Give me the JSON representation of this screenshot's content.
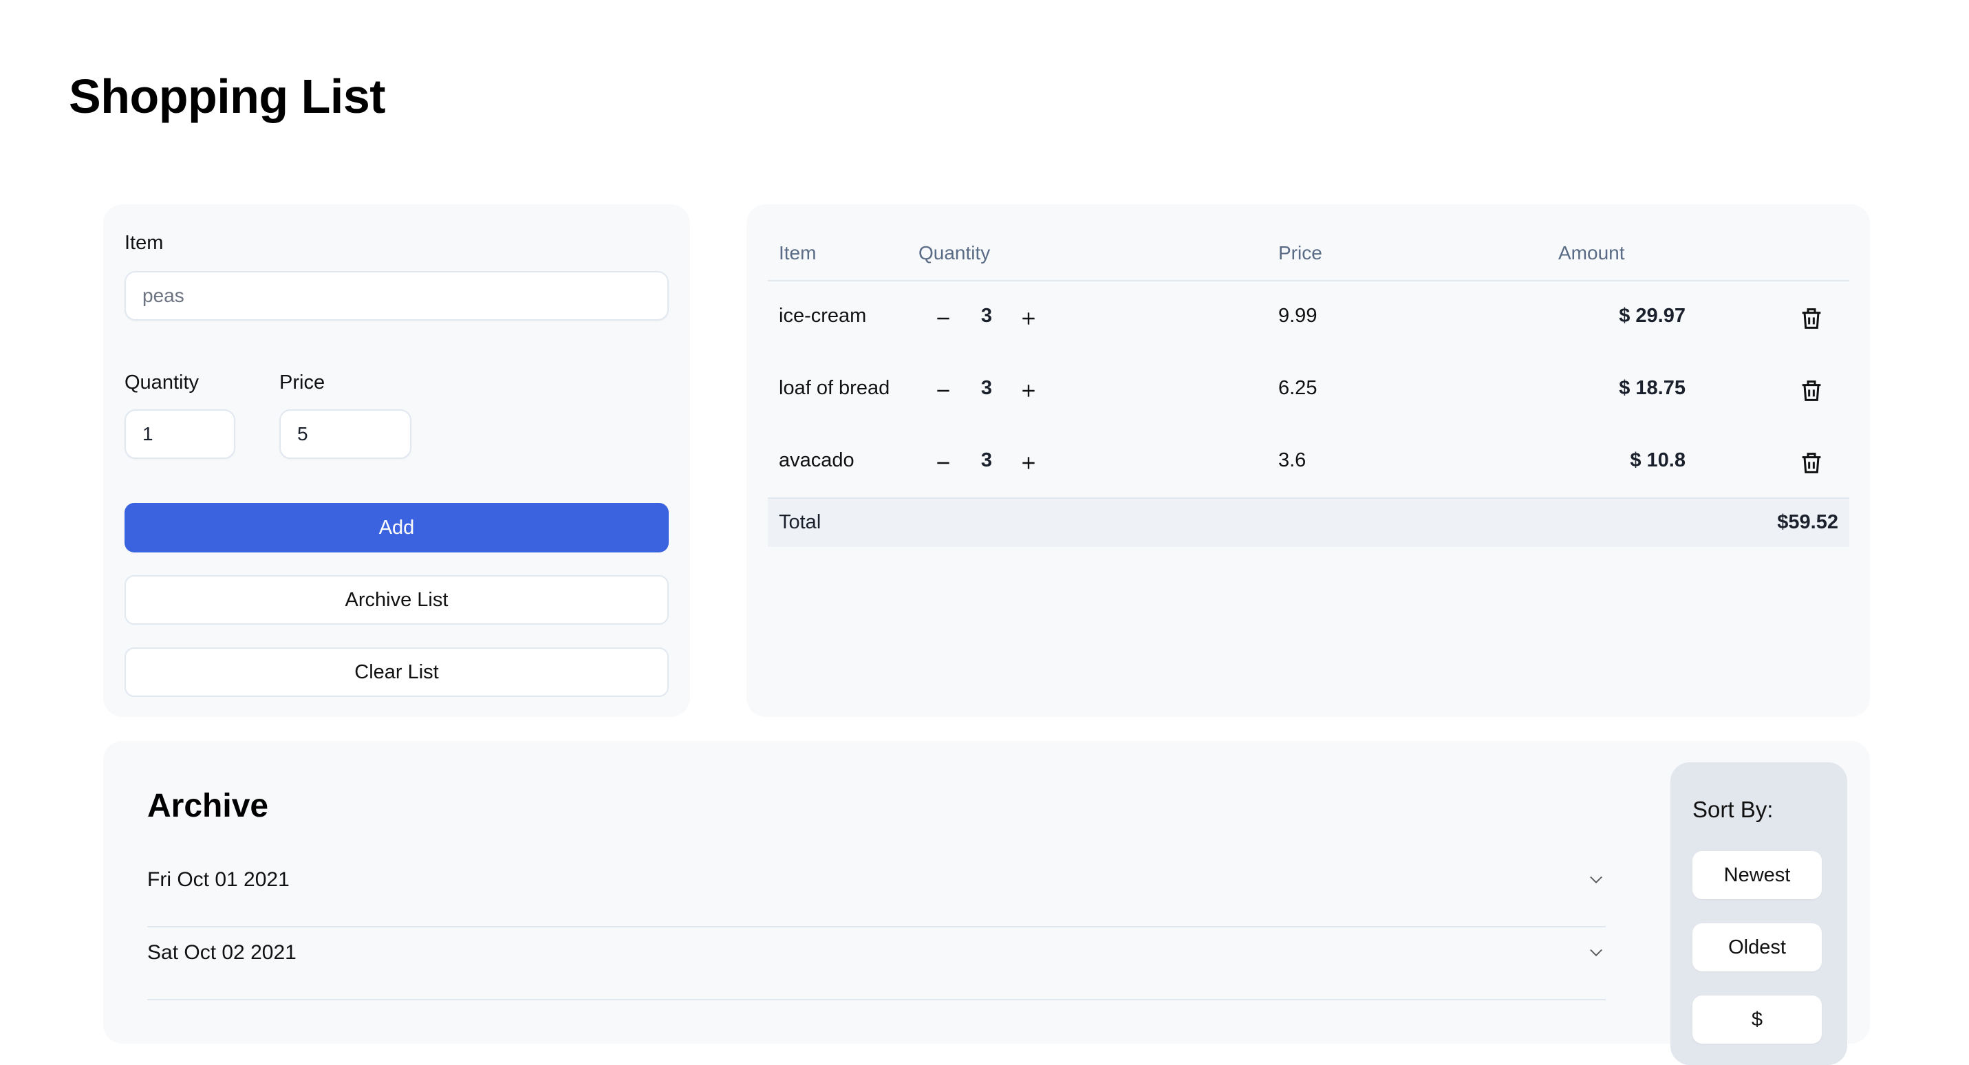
{
  "page": {
    "title": "Shopping List"
  },
  "form": {
    "item_label": "Item",
    "item_placeholder": "peas",
    "item_value": "",
    "quantity_label": "Quantity",
    "quantity_value": "1",
    "price_label": "Price",
    "price_value": "5",
    "add_label": "Add",
    "archive_label": "Archive List",
    "clear_label": "Clear List"
  },
  "table": {
    "headers": {
      "item": "Item",
      "quantity": "Quantity",
      "price": "Price",
      "amount": "Amount"
    },
    "rows": [
      {
        "item": "ice-cream",
        "quantity": "3",
        "price": "9.99",
        "amount": "$ 29.97"
      },
      {
        "item": "loaf of bread",
        "quantity": "3",
        "price": "6.25",
        "amount": "$ 18.75"
      },
      {
        "item": "avacado",
        "quantity": "3",
        "price": "3.6",
        "amount": "$ 10.8"
      }
    ],
    "total_label": "Total",
    "total_value": "$59.52"
  },
  "archive": {
    "title": "Archive",
    "items": [
      {
        "date": "Fri Oct 01 2021"
      },
      {
        "date": "Sat Oct 02 2021"
      }
    ],
    "sort": {
      "title": "Sort By:",
      "options": [
        "Newest",
        "Oldest",
        "$"
      ]
    }
  },
  "colors": {
    "primary": "#3b63e0",
    "card_bg": "#f7f9fb",
    "sort_panel_bg": "#e2e6ed",
    "header_text": "#5a6b85"
  },
  "icons": {
    "minus": "minus-icon",
    "plus": "plus-icon",
    "delete": "trash-icon",
    "expand": "chevron-down-icon"
  }
}
